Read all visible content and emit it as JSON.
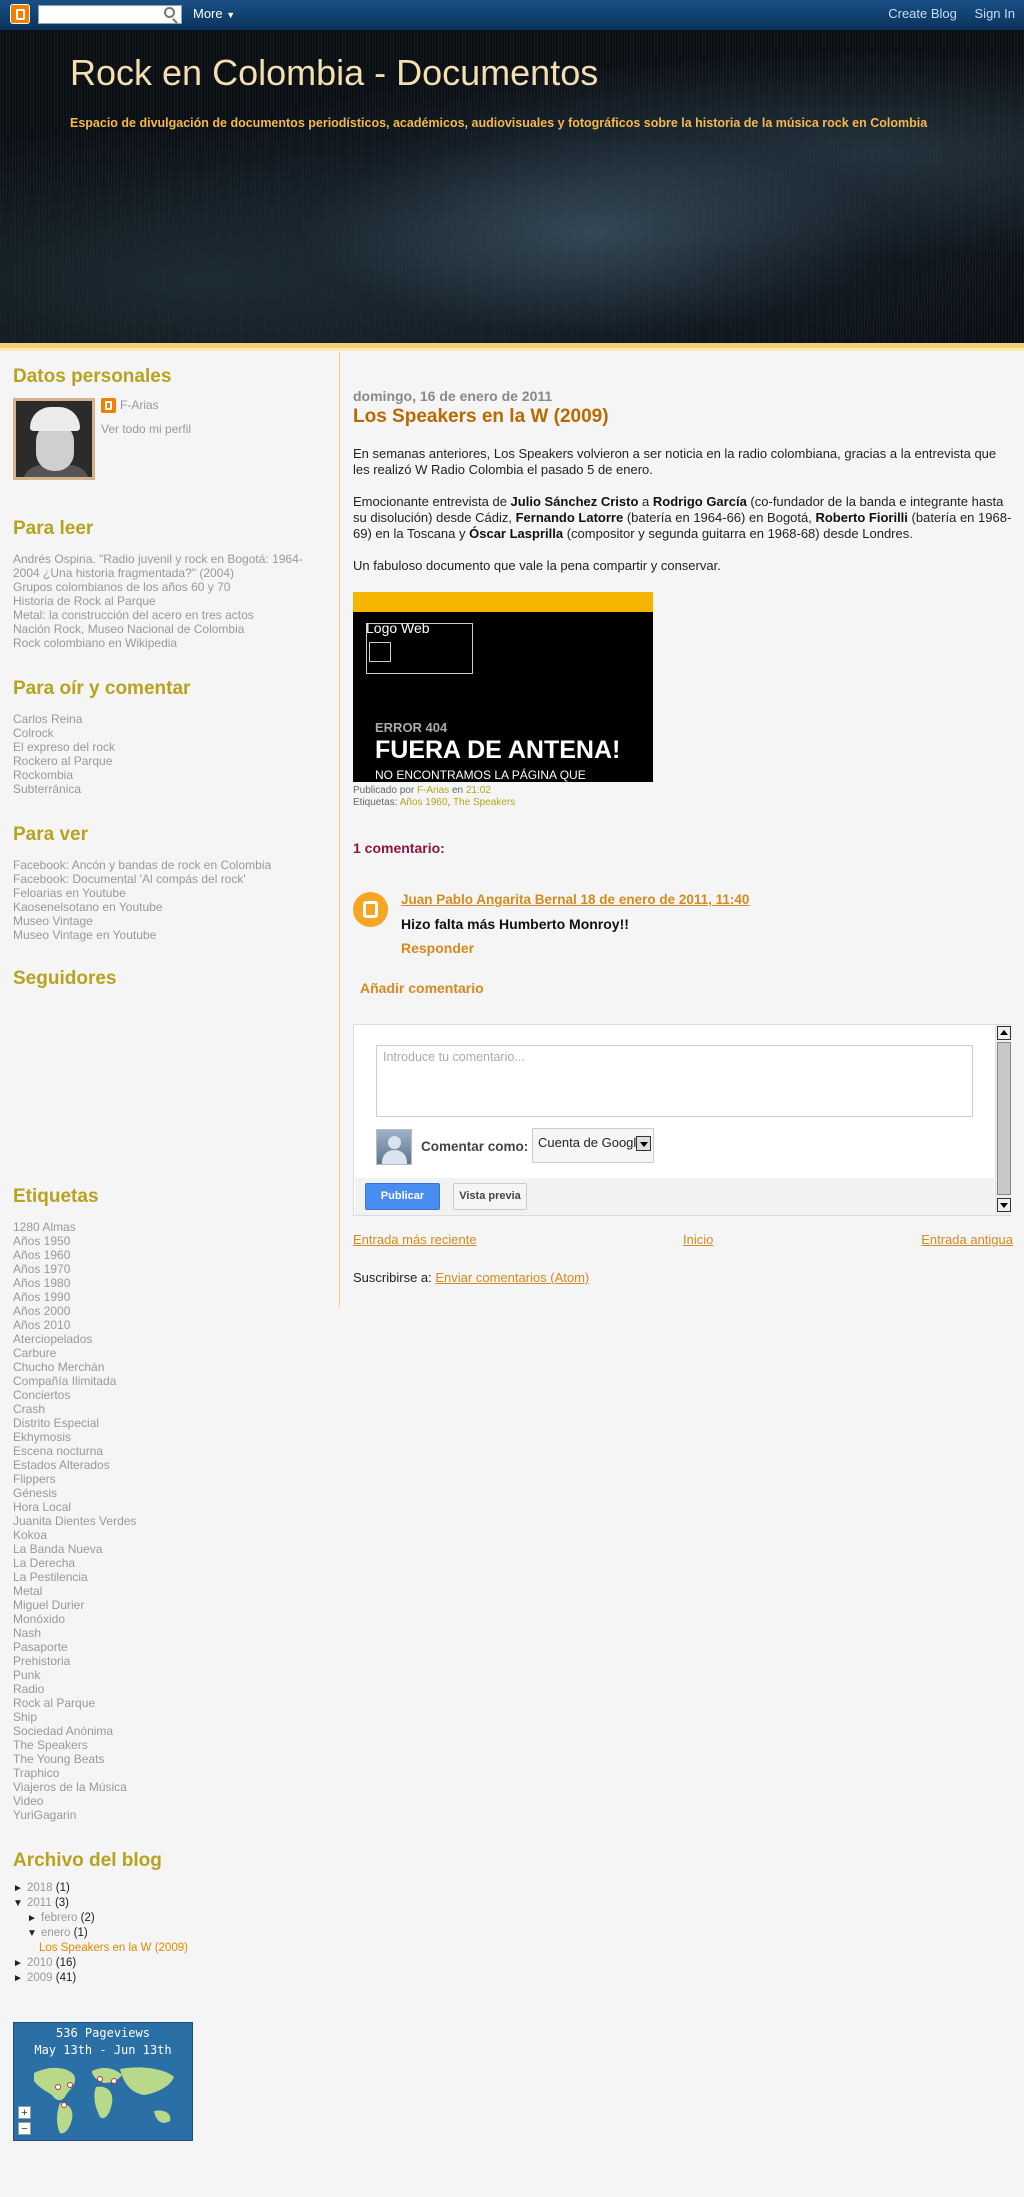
{
  "navbar": {
    "more_label": "More",
    "create_blog": "Create Blog",
    "sign_in": "Sign In"
  },
  "header": {
    "title": "Rock en Colombia - Documentos",
    "description": "Espacio de divulgación de documentos periodísticos, académicos, audiovisuales y fotográficos sobre la historia de la música rock en Colombia"
  },
  "sidebar": {
    "datos": {
      "heading": "Datos personales",
      "name": "F-Arias",
      "profile_link": "Ver todo mi perfil"
    },
    "para_leer": {
      "heading": "Para leer",
      "items": [
        "Andrés Ospina. \"Radio juvenil y rock en Bogotá: 1964-",
        "2004 ¿Una historia fragmentada?\" (2004)",
        "Grupos colombianos de los años 60 y 70",
        "Historia de Rock al Parque",
        "Metal: la construcción del acero en tres actos",
        "Nación Rock, Museo Nacional de Colombia",
        "Rock colombiano en Wikipedia"
      ]
    },
    "para_oir": {
      "heading": "Para oír y comentar",
      "items": [
        "Carlos Reina",
        "Colrock",
        "El expreso del rock",
        "Rockero al Parque",
        "Rockombia",
        "Subterránica"
      ]
    },
    "para_ver": {
      "heading": "Para ver",
      "items": [
        "Facebook: Ancón y bandas de rock en Colombia",
        "Facebook: Documental 'Al compás del rock'",
        "Feloarias en Youtube",
        "Kaosenelsotano en Youtube",
        "Museo Vintage",
        "Museo Vintage en Youtube"
      ]
    },
    "seguidores": {
      "heading": "Seguidores"
    },
    "etiquetas": {
      "heading": "Etiquetas",
      "items": [
        "1280 Almas",
        "Años 1950",
        "Años 1960",
        "Años 1970",
        "Años 1980",
        "Años 1990",
        "Años 2000",
        "Años 2010",
        "Aterciopelados",
        "Carbure",
        "Chucho Merchán",
        "Compañía Ilimitada",
        "Conciertos",
        "Crash",
        "Distrito Especial",
        "Ekhymosis",
        "Escena nocturna",
        "Estados Alterados",
        "Flippers",
        "Génesis",
        "Hora Local",
        "Juanita Dientes Verdes",
        "Kokoa",
        "La Banda Nueva",
        "La Derecha",
        "La Pestilencia",
        "Metal",
        "Miguel Durier",
        "Monóxido",
        "Nash",
        "Pasaporte",
        "Prehistoria",
        "Punk",
        "Radio",
        "Rock al Parque",
        "Ship",
        "Sociedad Anónima",
        "The Speakers",
        "The Young Beats",
        "Traphico",
        "Viajeros de la Música",
        "Video",
        "YuriGagarin"
      ]
    },
    "archivo": {
      "heading": "Archivo del blog",
      "y2018": {
        "toggle": "►",
        "label": "2018",
        "count": "(1)"
      },
      "y2011": {
        "toggle": "▼",
        "label": "2011",
        "count": "(3)"
      },
      "febrero": {
        "toggle": "►",
        "label": "febrero",
        "count": "(2)"
      },
      "enero": {
        "toggle": "▼",
        "label": "enero",
        "count": "(1)"
      },
      "post": "Los Speakers en la W (2009)",
      "y2010": {
        "toggle": "►",
        "label": "2010",
        "count": "(16)"
      },
      "y2009": {
        "toggle": "►",
        "label": "2009",
        "count": "(41)"
      }
    },
    "pageviews": {
      "line1": "536 Pageviews",
      "line2": "May 13th - Jun 13th",
      "zoom_in": "+",
      "zoom_out": "−"
    }
  },
  "post": {
    "date": "domingo, 16 de enero de 2011",
    "title": "Los Speakers en la W (2009)",
    "p1": "En semanas anteriores, Los Speakers volvieron a ser noticia en la radio colombiana, gracias a la entrevista que les realizó W Radio Colombia el pasado 5 de enero.",
    "p2": {
      "t1": "Emocionante entrevista de ",
      "b1": "Julio Sánchez Cristo",
      "t2": " a ",
      "b2": "Rodrigo García",
      "t3": " (co-fundador de la banda e integrante hasta su disolución) desde Cádiz, ",
      "b3": "Fernando Latorre",
      "t4": " (batería en 1964-66) en Bogotá, ",
      "b4": "Roberto Fiorilli",
      "t5": " (batería en 1968-69) en la Toscana y ",
      "b5": "Óscar Lasprilla",
      "t6": " (compositor y segunda guitarra en 1968-68) desde Londres."
    },
    "p3": "Un fabuloso documento que vale la pena compartir y conservar.",
    "embed": {
      "logo": "Logo Web",
      "error": "ERROR 404",
      "big": "FUERA DE ANTENA!",
      "sub": "NO ENCONTRAMOS LA PÁGINA QUE"
    },
    "footer": {
      "published_by": "Publicado por",
      "author": "F-Arias",
      "at": "en",
      "time": "21:02",
      "labels_prefix": "Etiquetas:",
      "label1": "Años 1960",
      "sep": ",",
      "label2": "The Speakers"
    }
  },
  "comments": {
    "heading": "1 comentario:",
    "author_line": "Juan Pablo Angarita Bernal  18 de enero de 2011, 11:40",
    "text": "Hizo falta más Humberto Monroy!!",
    "reply": "Responder",
    "add": "Añadir comentario",
    "form": {
      "placeholder": "Introduce tu comentario...",
      "comment_as": "Comentar como:",
      "select_value": "Cuenta de Google",
      "publish": "Publicar",
      "preview": "Vista previa"
    }
  },
  "pager": {
    "newer": "Entrada más reciente",
    "home": "Inicio",
    "older": "Entrada antigua"
  },
  "subscribe": {
    "label": "Suscribirse a:",
    "link": "Enviar comentarios (Atom)"
  }
}
